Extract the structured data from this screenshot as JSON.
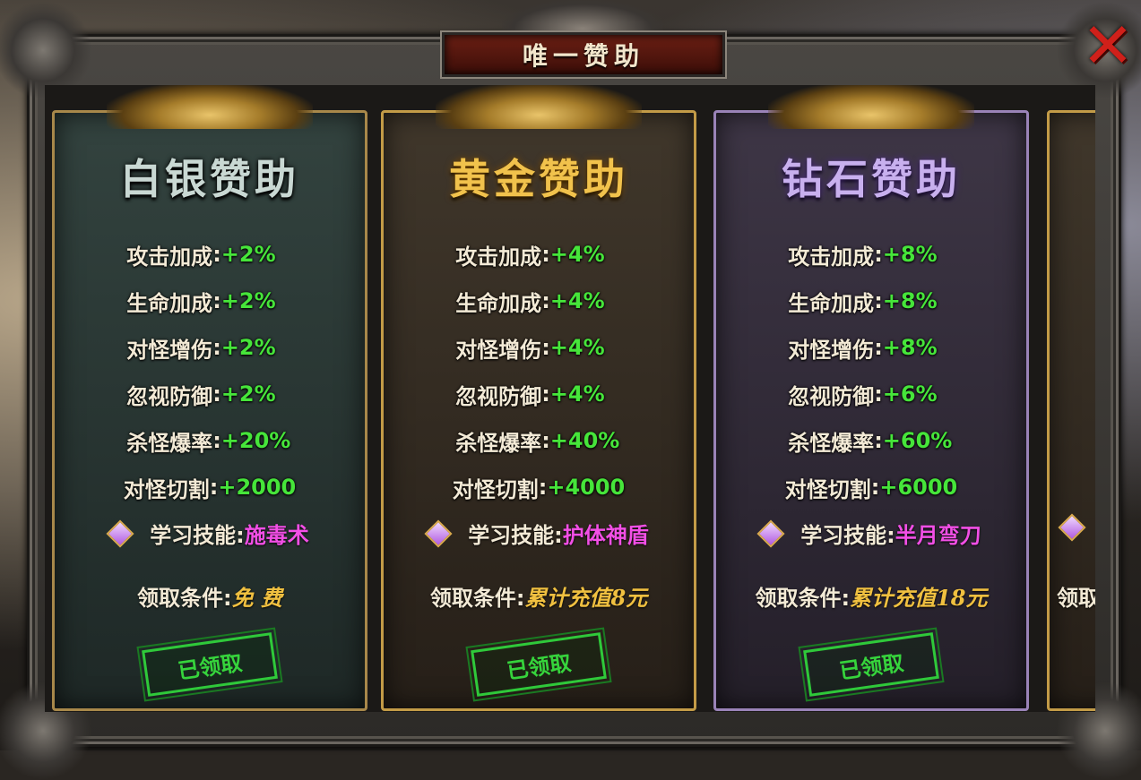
{
  "dialog": {
    "title": "唯一赞助",
    "close_icon": "close-x-icon"
  },
  "cards": [
    {
      "tier": "silver",
      "title": "白银赞助",
      "stats": [
        {
          "label": "攻击加成",
          "value": "+2%"
        },
        {
          "label": "生命加成",
          "value": "+2%"
        },
        {
          "label": "对怪增伤",
          "value": "+2%"
        },
        {
          "label": "忽视防御",
          "value": "+2%"
        },
        {
          "label": "杀怪爆率",
          "value": "+20%"
        },
        {
          "label": "对怪切割",
          "value": "+2000"
        }
      ],
      "skill_label": "学习技能:",
      "skill_value": "施毒术",
      "condition_label": "领取条件:",
      "condition_value": "免 费",
      "status": "已领取"
    },
    {
      "tier": "gold",
      "title": "黄金赞助",
      "stats": [
        {
          "label": "攻击加成",
          "value": "+4%"
        },
        {
          "label": "生命加成",
          "value": "+4%"
        },
        {
          "label": "对怪增伤",
          "value": "+4%"
        },
        {
          "label": "忽视防御",
          "value": "+4%"
        },
        {
          "label": "杀怪爆率",
          "value": "+40%"
        },
        {
          "label": "对怪切割",
          "value": "+4000"
        }
      ],
      "skill_label": "学习技能:",
      "skill_value": "护体神盾",
      "condition_label": "领取条件:",
      "condition_value": "累计充值8元",
      "status": "已领取"
    },
    {
      "tier": "diamond",
      "title": "钻石赞助",
      "stats": [
        {
          "label": "攻击加成",
          "value": "+8%"
        },
        {
          "label": "生命加成",
          "value": "+8%"
        },
        {
          "label": "对怪增伤",
          "value": "+8%"
        },
        {
          "label": "忽视防御",
          "value": "+6%"
        },
        {
          "label": "杀怪爆率",
          "value": "+60%"
        },
        {
          "label": "对怪切割",
          "value": "+6000"
        }
      ],
      "skill_label": "学习技能:",
      "skill_value": "半月弯刀",
      "condition_label": "领取条件:",
      "condition_value": "累计充值18元",
      "status": "已领取"
    }
  ],
  "partial_card": {
    "condition_fragment": "领取"
  },
  "colors": {
    "stat_value": "#46e53a",
    "skill_value": "#f24fe6",
    "condition_value": "#f0c040",
    "claimed_stamp": "#36d43c",
    "close_x": "#d0201a"
  }
}
